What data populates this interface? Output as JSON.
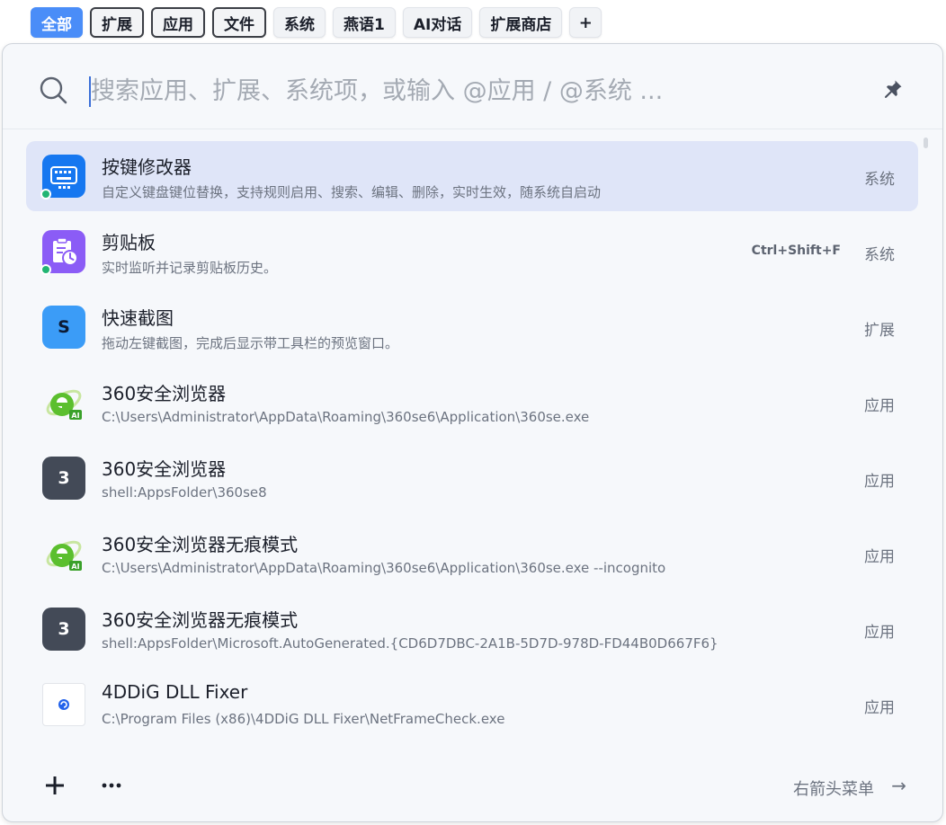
{
  "tabs": [
    {
      "label": "全部",
      "state": "active"
    },
    {
      "label": "扩展",
      "state": "outlined"
    },
    {
      "label": "应用",
      "state": "outlined"
    },
    {
      "label": "文件",
      "state": "outlined"
    },
    {
      "label": "系统",
      "state": "plain"
    },
    {
      "label": "燕语1",
      "state": "plain"
    },
    {
      "label": "AI对话",
      "state": "plain"
    },
    {
      "label": "扩展商店",
      "state": "plain"
    },
    {
      "label": "+",
      "state": "plain"
    }
  ],
  "search": {
    "placeholder": "搜索应用、扩展、系统项，或输入 @应用 / @系统 ...",
    "value": ""
  },
  "results": [
    {
      "title": "按键修改器",
      "subtitle": "自定义键盘键位替换，支持规则启用、搜索、编辑、删除，实时生效，随系统自启动",
      "kind": "系统",
      "icon": "keyboard-icon",
      "shortcut": ""
    },
    {
      "title": "剪贴板",
      "subtitle": "实时监听并记录剪贴板历史。",
      "kind": "系统",
      "icon": "clipboard-icon",
      "shortcut": "Ctrl+Shift+F"
    },
    {
      "title": "快速截图",
      "subtitle": "拖动左键截图，完成后显示带工具栏的预览窗口。",
      "kind": "扩展",
      "icon": "s-letter-icon",
      "letter": "S",
      "shortcut": ""
    },
    {
      "title": "360安全浏览器",
      "subtitle": "C:\\Users\\Administrator\\AppData\\Roaming\\360se6\\Application\\360se.exe",
      "kind": "应用",
      "icon": "360-browser-icon",
      "shortcut": ""
    },
    {
      "title": "360安全浏览器",
      "subtitle": "shell:AppsFolder\\360se8",
      "kind": "应用",
      "icon": "3-letter-icon",
      "letter": "3",
      "shortcut": ""
    },
    {
      "title": "360安全浏览器无痕模式",
      "subtitle": "C:\\Users\\Administrator\\AppData\\Roaming\\360se6\\Application\\360se.exe --incognito",
      "kind": "应用",
      "icon": "360-browser-icon",
      "shortcut": ""
    },
    {
      "title": "360安全浏览器无痕模式",
      "subtitle": "shell:AppsFolder\\Microsoft.AutoGenerated.{CD6D7DBC-2A1B-5D7D-978D-FD44B0D667F6}",
      "kind": "应用",
      "icon": "3-letter-icon",
      "letter": "3",
      "shortcut": ""
    },
    {
      "title": "4DDiG DLL Fixer",
      "subtitle": "C:\\Program Files (x86)\\4DDiG DLL Fixer\\NetFrameCheck.exe",
      "kind": "应用",
      "icon": "4ddig-icon",
      "shortcut": ""
    }
  ],
  "footer": {
    "hint": "右箭头菜单",
    "arrow": "→"
  },
  "colors": {
    "accent": "#4a8df8",
    "selected_row": "#dfe5f8",
    "status_dot": "#22b573"
  }
}
